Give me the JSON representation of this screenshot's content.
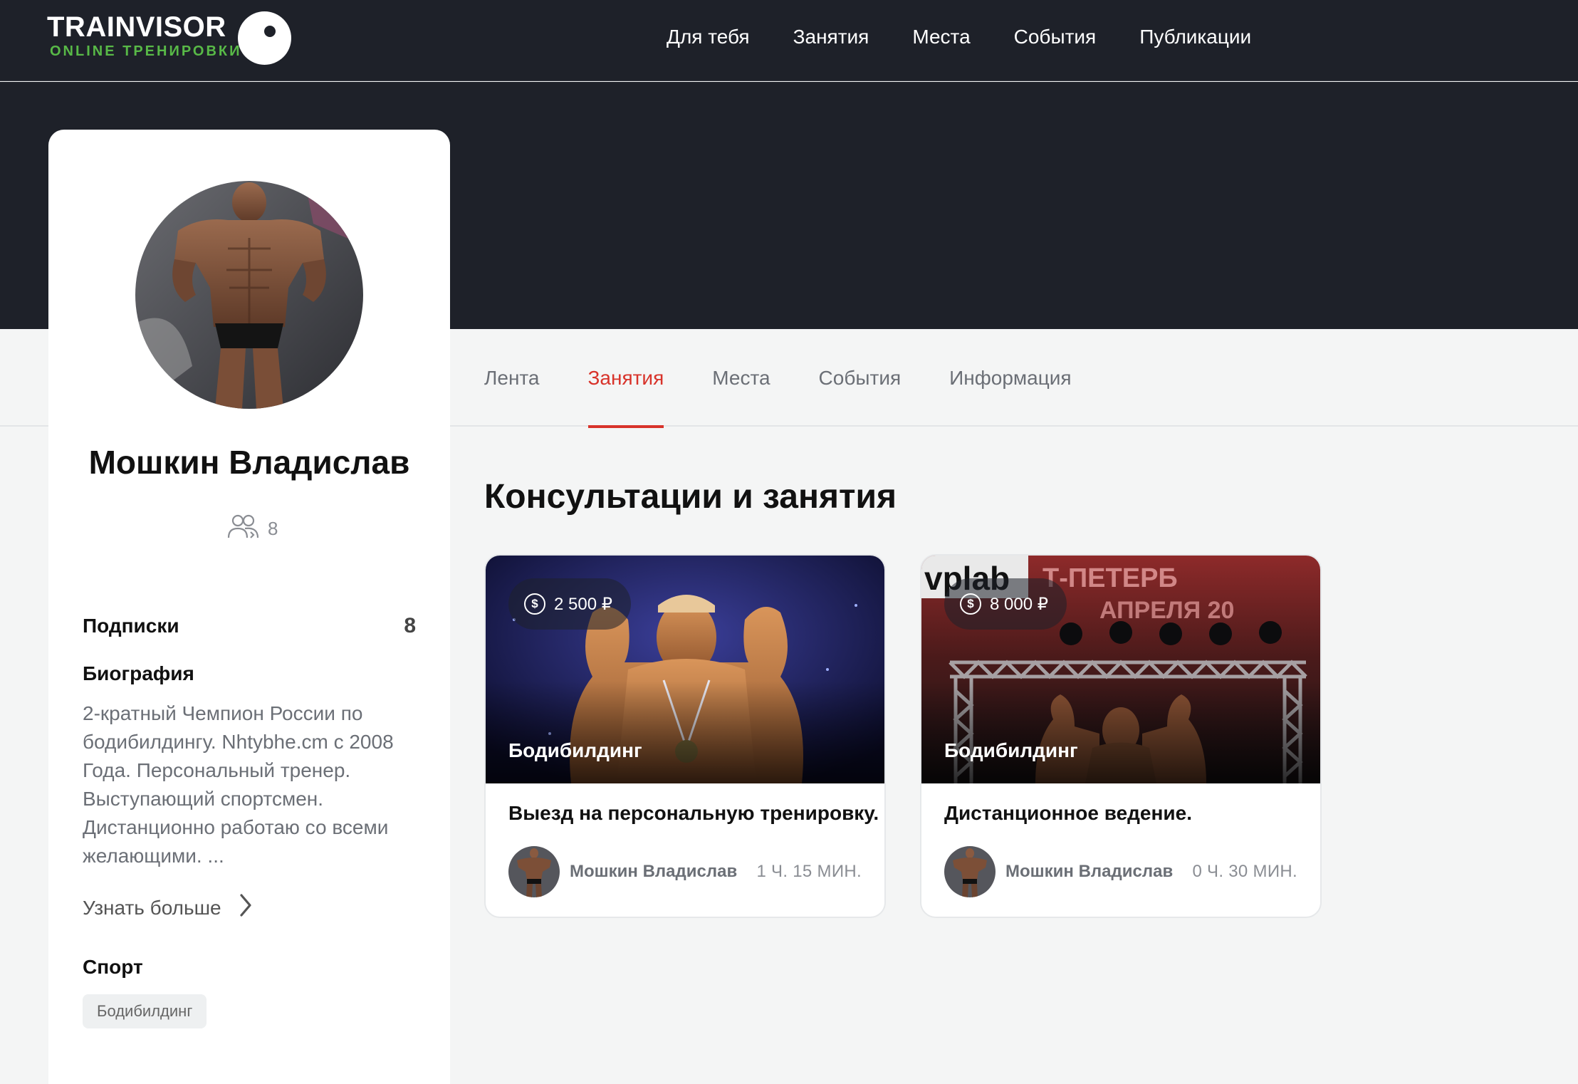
{
  "brand": {
    "name": "TRAINVISOR",
    "tagline": "ONLINE ТРЕНИРОВКИ"
  },
  "nav": {
    "items": [
      {
        "label": "Для тебя"
      },
      {
        "label": "Занятия"
      },
      {
        "label": "Места"
      },
      {
        "label": "События"
      },
      {
        "label": "Публикации"
      }
    ]
  },
  "profile": {
    "name": "Мошкин Владислав",
    "followers_count": "8",
    "subscriptions_label": "Подписки",
    "subscriptions_count": "8",
    "bio_title": "Биография",
    "bio_text": "2-кратный Чемпион России по бодибилдингу. Nhtybhe.cm с 2008 Года. Персональный тренер. Выступающий спортсмен. Дистанционно работаю со всеми желающими. ...",
    "more_label": "Узнать больше",
    "sport_title": "Спорт",
    "sports": [
      "Бодибилдинг"
    ]
  },
  "tabs": {
    "items": [
      {
        "label": "Лента"
      },
      {
        "label": "Занятия"
      },
      {
        "label": "Места"
      },
      {
        "label": "События"
      },
      {
        "label": "Информация"
      }
    ],
    "active": "Занятия"
  },
  "section": {
    "title": "Консультации и занятия"
  },
  "cards": [
    {
      "price": "2 500 ₽",
      "category": "Бодибилдинг",
      "title": "Выезд на персональную тренировку.",
      "author": "Мошкин Владислав",
      "duration": "1 Ч. 15 МИН."
    },
    {
      "price": "8 000 ₽",
      "category": "Бодибилдинг",
      "title": "Дистанционное ведение.",
      "author": "Мошкин Владислав",
      "duration": "0 Ч. 30 МИН.",
      "image_text": "vplab  Т-ПЕТЕРБ  АПРЕЛЯ 20"
    }
  ],
  "colors": {
    "header_bg": "#1e2129",
    "accent": "#d8332a",
    "brand_green": "#58b947",
    "page_bg": "#f4f5f5"
  },
  "icons": {
    "followers": "followers-icon",
    "chevron": "chevron-right-icon",
    "price": "dollar-coin-icon"
  }
}
